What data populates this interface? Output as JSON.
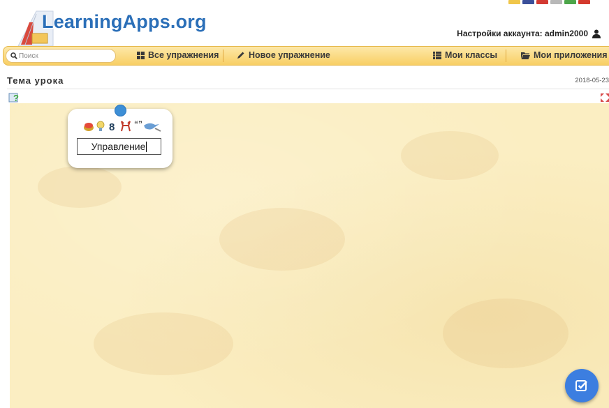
{
  "header": {
    "logo_text": "LearningApps.org",
    "account_label": "Настройки аккаунта: admin2000"
  },
  "flags": [
    {
      "name": "flag-yellow",
      "color": "#f0c64a"
    },
    {
      "name": "flag-uk",
      "color": "#3a4f9a"
    },
    {
      "name": "flag-red",
      "color": "#d33a32"
    },
    {
      "name": "flag-grey",
      "color": "#b8b8b8"
    },
    {
      "name": "flag-italy",
      "color": "#4da64a"
    },
    {
      "name": "flag-red2",
      "color": "#d43a2e"
    }
  ],
  "nav": {
    "search_placeholder": "Поиск",
    "all_exercises": "Все упражнения",
    "new_exercise": "Новое упражнение",
    "my_classes": "Мои классы",
    "my_apps": "Мои приложения"
  },
  "page": {
    "title": "Тема урока",
    "date": "2018-05-23"
  },
  "card": {
    "input_value": "Управление",
    "icons": [
      "book-icon",
      "lightbulb-icon",
      "number-eight-icon",
      "reindeer-icon",
      "quote-icon",
      "bird-icon"
    ]
  },
  "colors": {
    "accent": "#3c7ee0",
    "navbar": "#f8cf64",
    "canvas": "#fbeec2",
    "logo": "#2b6fb8"
  },
  "icons": {
    "help": "help-edit-icon",
    "fullscreen": "fullscreen-icon",
    "fab": "check-edit-icon"
  }
}
